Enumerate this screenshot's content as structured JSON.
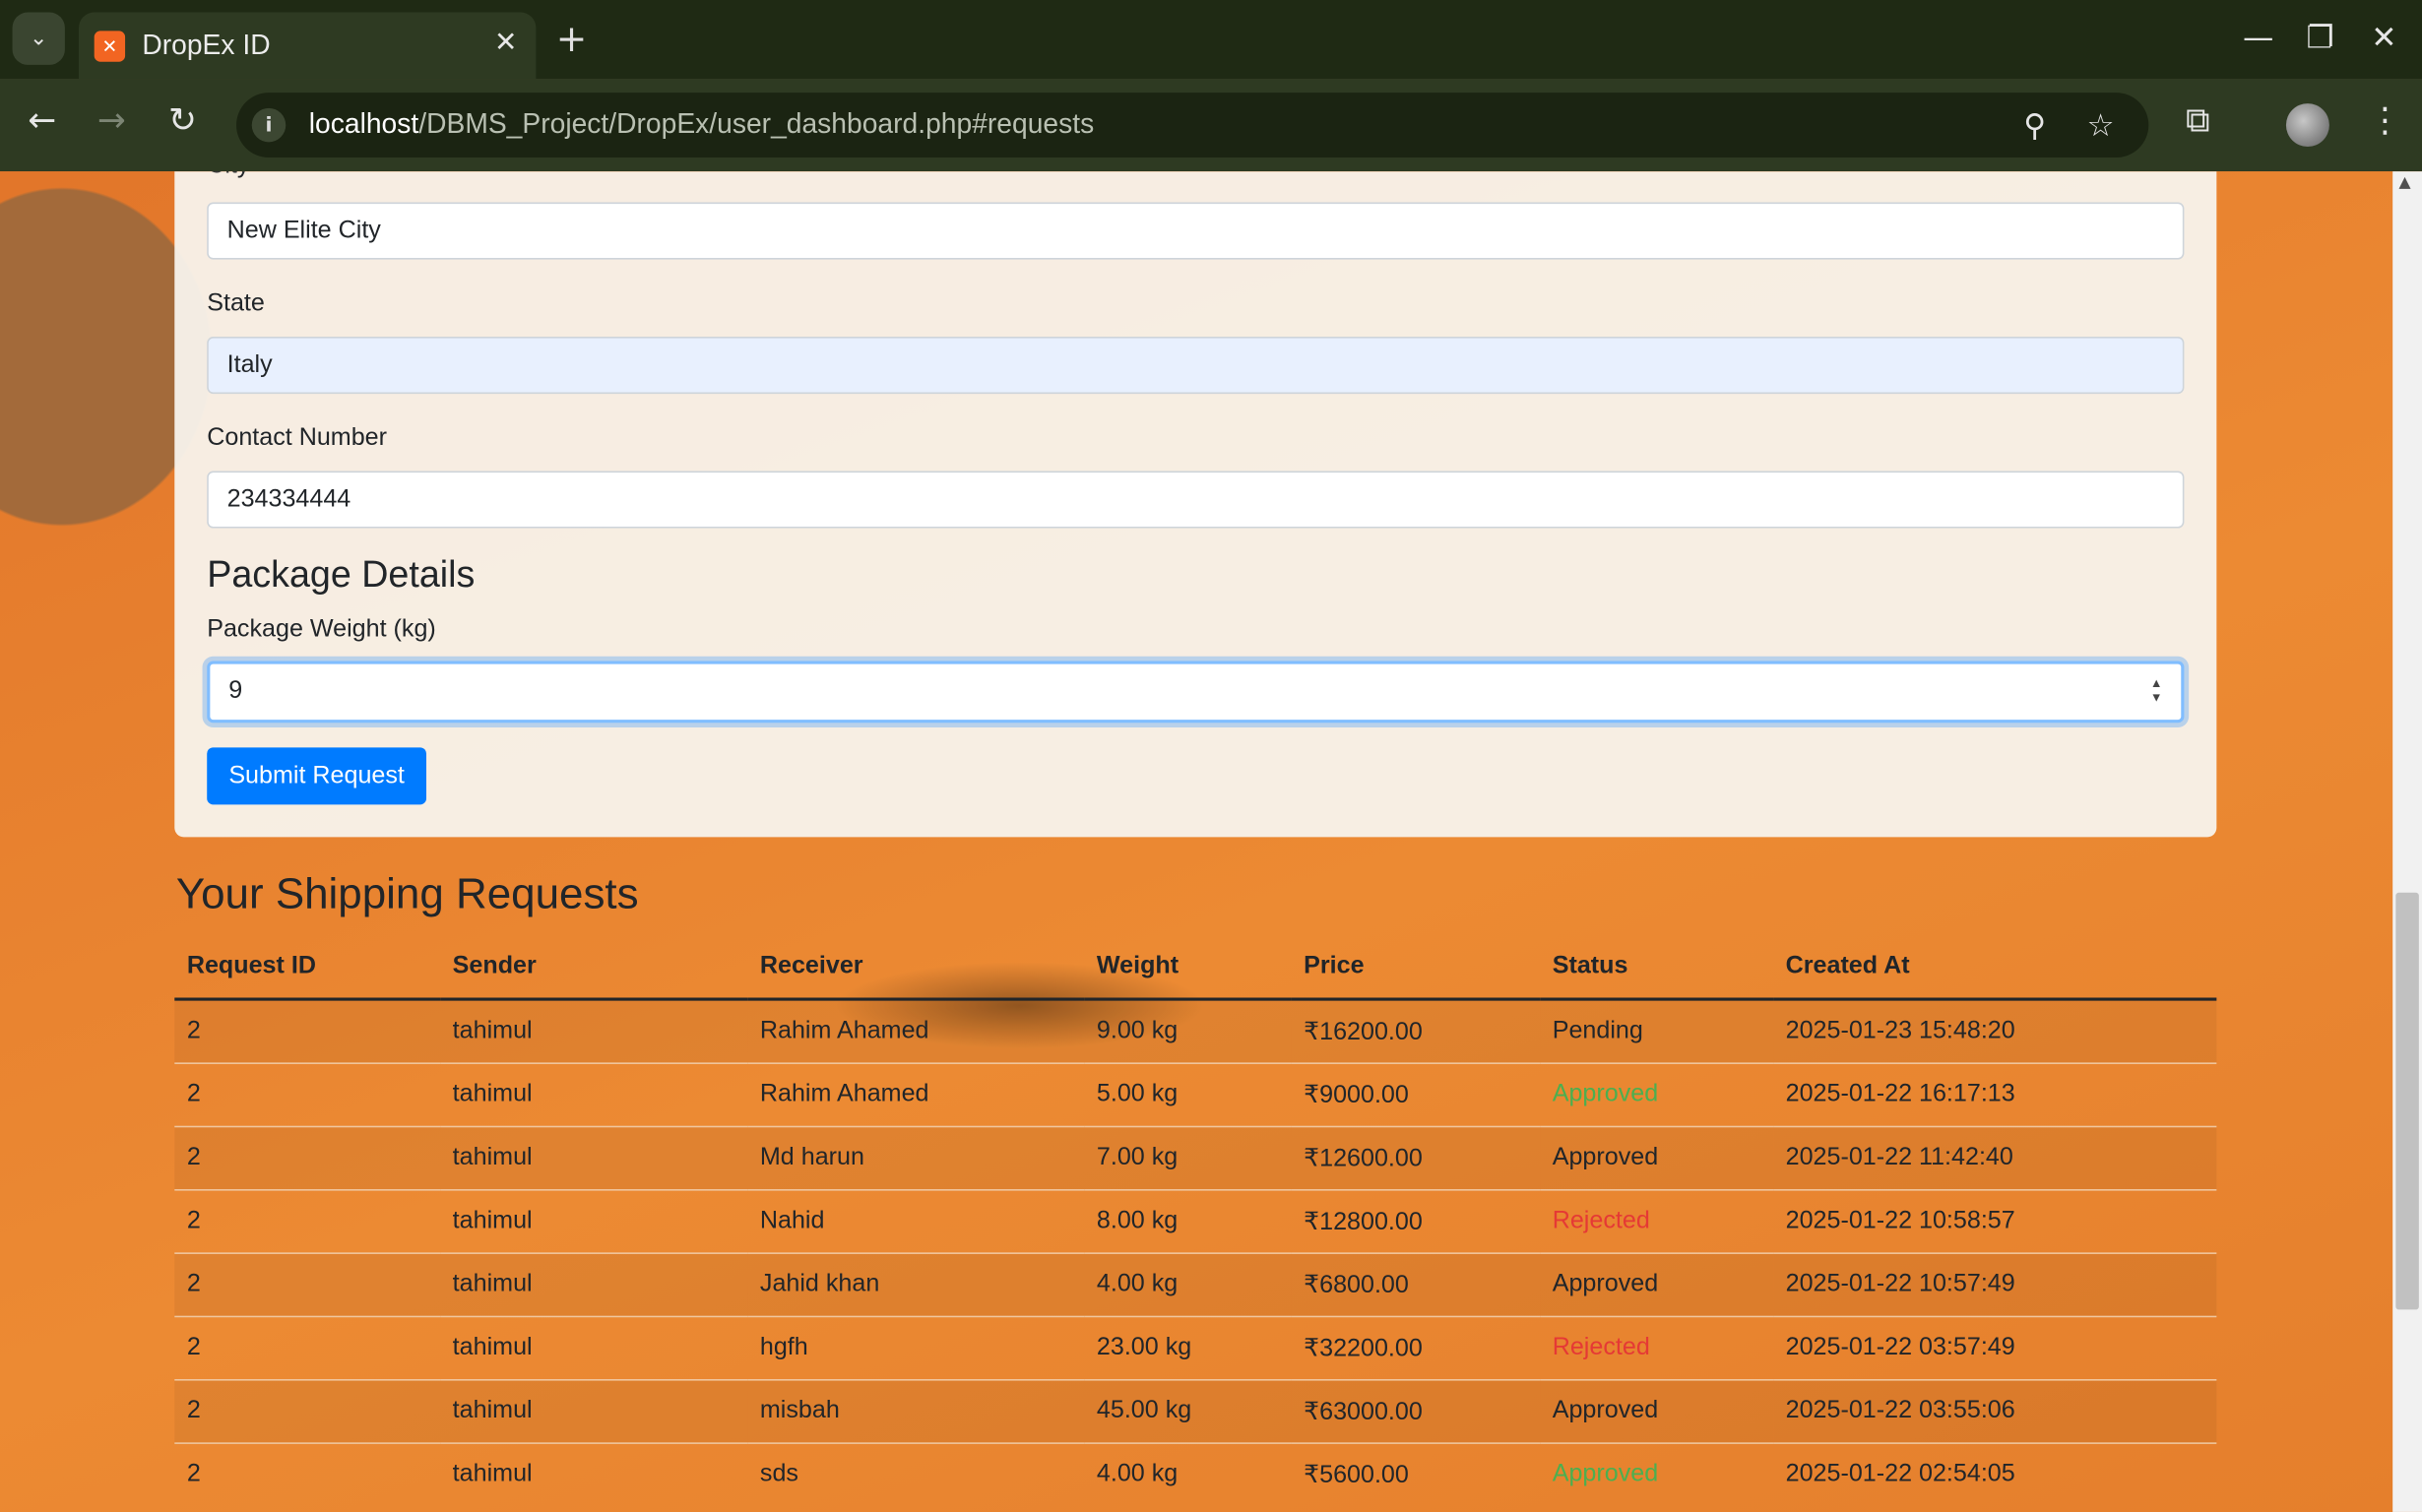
{
  "browser": {
    "tab_title": "DropEx ID",
    "url_host": "localhost",
    "url_path": "/DBMS_Project/DropEx/user_dashboard.php#requests"
  },
  "form": {
    "city_label": "City",
    "city_value": "New Elite City",
    "state_label": "State",
    "state_value": "Italy",
    "contact_label": "Contact Number",
    "contact_value": "234334444",
    "package_section_title": "Package Details",
    "weight_label": "Package Weight (kg)",
    "weight_value": "9",
    "submit_label": "Submit Request"
  },
  "requests": {
    "title": "Your Shipping Requests",
    "columns": [
      "Request ID",
      "Sender",
      "Receiver",
      "Weight",
      "Price",
      "Status",
      "Created At"
    ],
    "rows": [
      {
        "id": "2",
        "sender": "tahimul",
        "receiver": "Rahim Ahamed",
        "weight": "9.00 kg",
        "price": "₹16200.00",
        "status": "Pending",
        "created": "2025-01-23 15:48:20"
      },
      {
        "id": "2",
        "sender": "tahimul",
        "receiver": "Rahim Ahamed",
        "weight": "5.00 kg",
        "price": "₹9000.00",
        "status": "Approved",
        "created": "2025-01-22 16:17:13"
      },
      {
        "id": "2",
        "sender": "tahimul",
        "receiver": "Md harun",
        "weight": "7.00 kg",
        "price": "₹12600.00",
        "status": "Approved",
        "created": "2025-01-22 11:42:40"
      },
      {
        "id": "2",
        "sender": "tahimul",
        "receiver": "Nahid",
        "weight": "8.00 kg",
        "price": "₹12800.00",
        "status": "Rejected",
        "created": "2025-01-22 10:58:57"
      },
      {
        "id": "2",
        "sender": "tahimul",
        "receiver": "Jahid khan",
        "weight": "4.00 kg",
        "price": "₹6800.00",
        "status": "Approved",
        "created": "2025-01-22 10:57:49"
      },
      {
        "id": "2",
        "sender": "tahimul",
        "receiver": "hgfh",
        "weight": "23.00 kg",
        "price": "₹32200.00",
        "status": "Rejected",
        "created": "2025-01-22 03:57:49"
      },
      {
        "id": "2",
        "sender": "tahimul",
        "receiver": "misbah",
        "weight": "45.00 kg",
        "price": "₹63000.00",
        "status": "Approved",
        "created": "2025-01-22 03:55:06"
      },
      {
        "id": "2",
        "sender": "tahimul",
        "receiver": "sds",
        "weight": "4.00 kg",
        "price": "₹5600.00",
        "status": "Approved",
        "created": "2025-01-22 02:54:05"
      }
    ],
    "status_colors": [
      "",
      "#4caf50",
      "",
      "#e53935",
      "",
      "#e53935",
      "",
      "#4caf50"
    ]
  }
}
